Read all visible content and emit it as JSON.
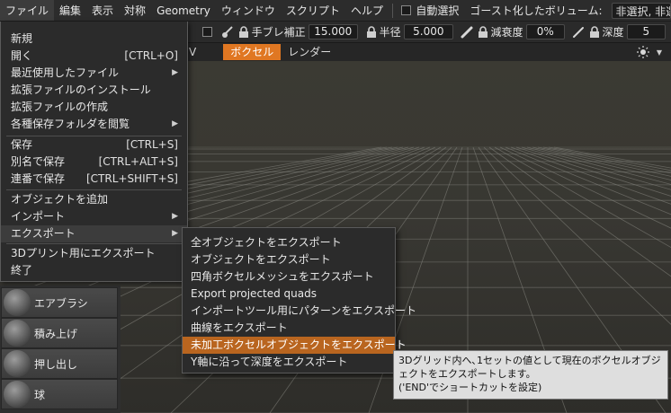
{
  "menubar": {
    "items": [
      "ファイル",
      "編集",
      "表示",
      "対称",
      "Geometry",
      "ウィンドウ",
      "スクリプト",
      "ヘルプ"
    ],
    "auto_select_label": "自動選択",
    "ghost_volume_label": "ゴースト化したボリューム:",
    "ghost_volume_value": "非選択, 非選"
  },
  "toolbar": {
    "smoothing_label": "手ブレ補正",
    "smoothing_value": "15.000",
    "radius_label": "半径",
    "radius_value": "5.000",
    "falloff_label": "減衰度",
    "falloff_value": "0%",
    "depth_label": "深度",
    "depth_value": "5"
  },
  "tabs": {
    "partial_left": "V",
    "voxels": "ボクセル",
    "render": "レンダー"
  },
  "file_menu": {
    "new": "新規",
    "open": "開く",
    "open_shortcut": "[CTRL+O]",
    "recent": "最近使用したファイル",
    "install_ext": "拡張ファイルのインストール",
    "create_ext": "拡張ファイルの作成",
    "browse_folders": "各種保存フォルダを閲覧",
    "save": "保存",
    "save_shortcut": "[CTRL+S]",
    "save_as": "別名で保存",
    "save_as_shortcut": "[CTRL+ALT+S]",
    "incremental_save": "連番で保存",
    "incremental_save_shortcut": "[CTRL+SHIFT+S]",
    "add_object": "オブジェクトを追加",
    "import": "インポート",
    "export": "エクスポート",
    "export_3d_print": "3Dプリント用にエクスポート",
    "quit": "終了"
  },
  "export_menu": {
    "items": [
      "全オブジェクトをエクスポート",
      "オブジェクトをエクスポート",
      "四角ボクセルメッシュをエクスポート",
      "Export projected quads",
      "インポートツール用にパターンをエクスポート",
      "曲線をエクスポート",
      "未加工ボクセルオブジェクトをエクスポート",
      "Y軸に沿って深度をエクスポート"
    ],
    "highlighted_index": 6
  },
  "tooltip": {
    "line1": "3Dグリッド内へ､1セットの値として現在のボクセルオブジ",
    "line2": "ェクトをエクスポートします。",
    "line3": "('END'でショートカットを設定)"
  },
  "tool_panel": {
    "tools": [
      "エアブラシ",
      "積み上げ",
      "押し出し",
      "球"
    ]
  },
  "colors": {
    "accent": "#e07722",
    "menu_highlight": "#b9651f",
    "menu_bg": "#2b2b2b",
    "grid": "#8a8a84"
  }
}
